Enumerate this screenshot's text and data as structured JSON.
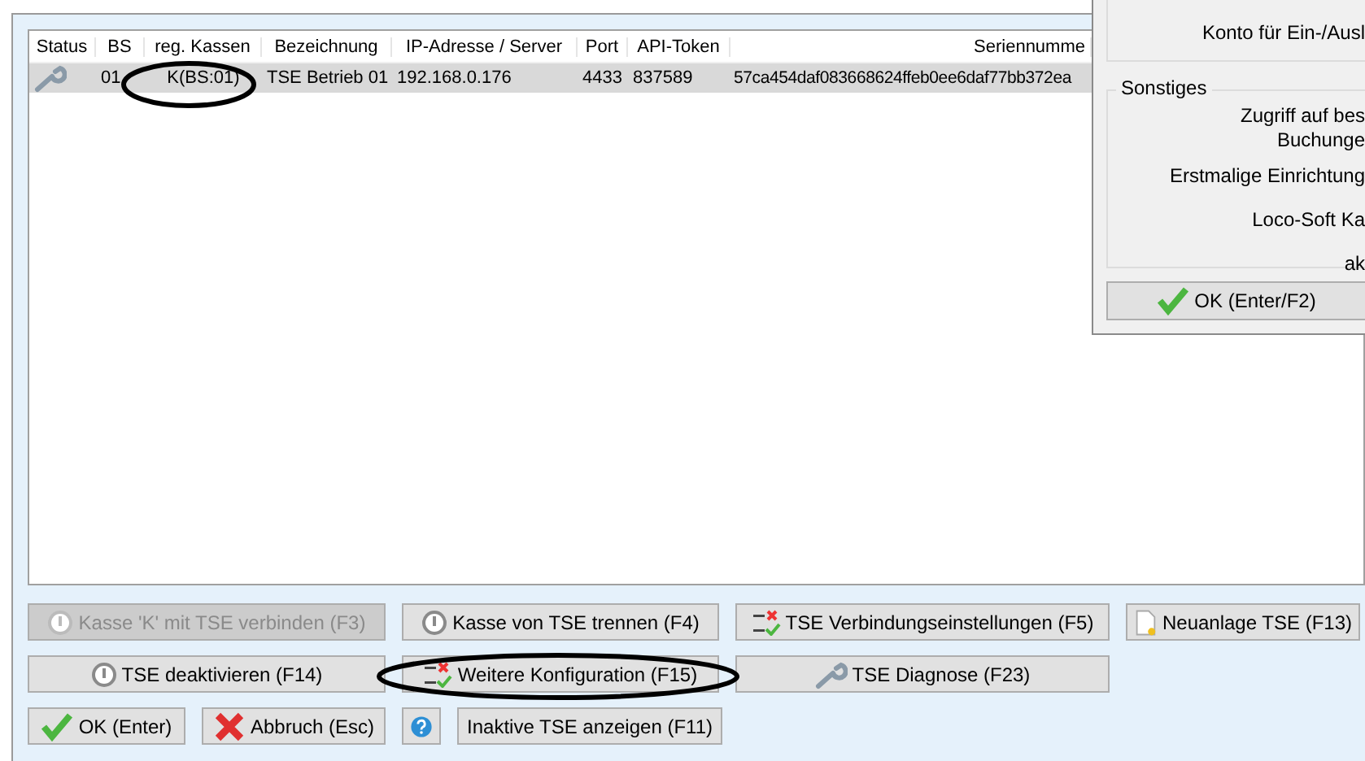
{
  "table": {
    "columns": [
      "Status",
      "BS",
      "reg. Kassen",
      "Bezeichnung",
      "IP-Adresse / Server",
      "Port",
      "API-Token",
      "Seriennumme"
    ],
    "rows": [
      {
        "selected": true,
        "kind": "wrench",
        "cells": [
          "",
          "01",
          "K(BS:01)",
          "TSE Betrieb 01",
          "192.168.0.176",
          "4433",
          "837589",
          "57ca454daf083668624ffeb0ee6daf77bb372ea"
        ]
      }
    ]
  },
  "buttons": [
    [
      {
        "label": "Kasse 'K' mit TSE verbinden (F3)",
        "kind": "power",
        "disabled": true
      },
      {
        "label": "Kasse von TSE trennen (F4)",
        "kind": "power",
        "disabled": false
      },
      {
        "label": "TSE Verbindungseinstellungen (F5)",
        "kind": "config",
        "disabled": false
      },
      {
        "label": "Neuanlage TSE (F13)",
        "kind": "newdoc",
        "disabled": false
      }
    ],
    [
      {
        "label": "TSE deaktivieren (F14)",
        "kind": "power",
        "disabled": false
      },
      {
        "label": "Weitere Konfiguration (F15)",
        "kind": "config",
        "disabled": false
      },
      {
        "label": "TSE Diagnose (F23)",
        "kind": "wrench",
        "disabled": false
      }
    ],
    [
      {
        "label": "OK (Enter)",
        "kind": "check",
        "disabled": false
      },
      {
        "label": "Abbruch (Esc)",
        "kind": "cross",
        "disabled": false
      },
      {
        "kind": "help",
        "disabled": false
      },
      {
        "label": "Inaktive TSE anzeigen (F11)",
        "kind": "plain",
        "disabled": false
      }
    ]
  ],
  "dialog": {
    "top_group": {
      "lines": [
        "Konto für Ein-/Ausl"
      ]
    },
    "sonstiges": {
      "title": "Sonstiges",
      "lines": [
        "Zugriff auf bes",
        "Buchunge",
        "Erstmalige Einrichtung",
        "Loco-Soft Ka",
        "ak"
      ]
    },
    "ok_button": "OK (Enter/F2)"
  }
}
